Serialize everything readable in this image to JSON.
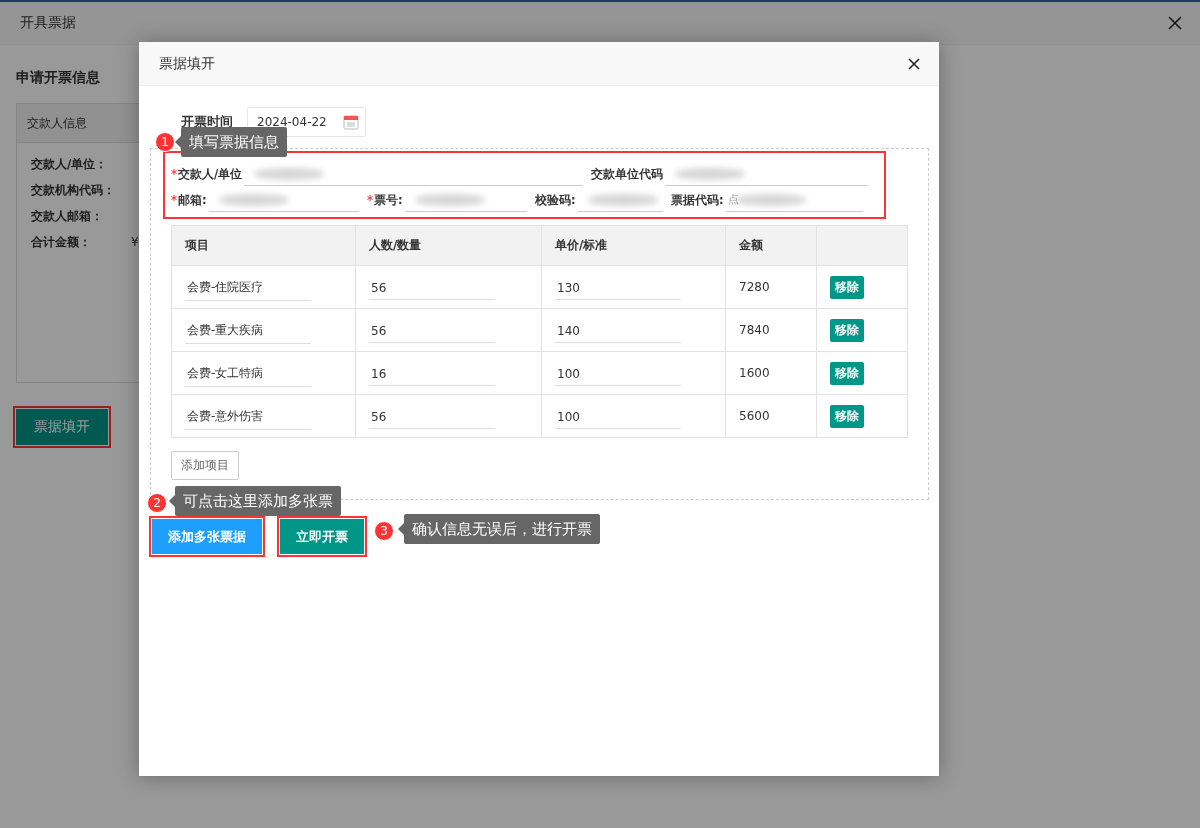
{
  "background_window": {
    "title": "开具票据",
    "section_title": "申请开票信息",
    "card_title": "交款人信息",
    "fields": [
      {
        "label": "交款人/单位："
      },
      {
        "label": "交款机构代码："
      },
      {
        "label": "交款人邮箱："
      },
      {
        "label": "合计金额：",
        "value": "¥"
      }
    ],
    "fill_button": "票据填开"
  },
  "dialog": {
    "title": "票据填开",
    "date_label": "开票时间",
    "date_value": "2024-04-22",
    "field_rows": [
      [
        {
          "label": "交款人/单位",
          "required": true,
          "blurred": true
        },
        {
          "label": "交款单位代码",
          "required": false,
          "blurred": true
        }
      ],
      [
        {
          "label": "邮箱:",
          "required": true,
          "blurred": true
        },
        {
          "label": "票号:",
          "required": true,
          "blurred": true
        },
        {
          "label": "校验码:",
          "required": false,
          "blurred": true
        },
        {
          "label": "票据代码:",
          "required": false,
          "blurred": true,
          "placeholder": "点"
        }
      ]
    ],
    "table": {
      "columns": [
        "项目",
        "人数/数量",
        "单价/标准",
        "金额"
      ],
      "rows": [
        {
          "item": "会费-住院医疗",
          "quantity": "56",
          "price": "130",
          "amount": "7280",
          "action": "移除"
        },
        {
          "item": "会费-重大疾病",
          "quantity": "56",
          "price": "140",
          "amount": "7840",
          "action": "移除"
        },
        {
          "item": "会费-女工特病",
          "quantity": "16",
          "price": "100",
          "amount": "1600",
          "action": "移除"
        },
        {
          "item": "会费-意外伤害",
          "quantity": "56",
          "price": "100",
          "amount": "5600",
          "action": "移除"
        }
      ]
    },
    "add_item_button": "添加项目",
    "add_multiple_button": "添加多张票据",
    "issue_button": "立即开票"
  },
  "callouts": [
    {
      "number": "1",
      "text": "填写票据信息"
    },
    {
      "number": "2",
      "text": "可点击这里添加多张票"
    },
    {
      "number": "3",
      "text": "确认信息无误后，进行开票"
    }
  ]
}
